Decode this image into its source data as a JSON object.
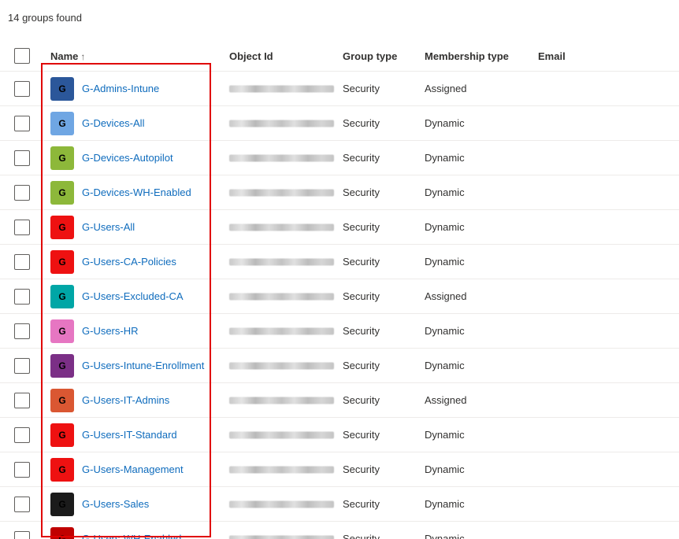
{
  "summary": "14 groups found",
  "columns": {
    "name": "Name",
    "sort_indicator": "↑",
    "object_id": "Object Id",
    "group_type": "Group type",
    "membership_type": "Membership type",
    "email": "Email"
  },
  "rows": [
    {
      "initial": "G",
      "name": "G-Admins-Intune",
      "group_type": "Security",
      "membership_type": "Assigned",
      "color": "#2b579a"
    },
    {
      "initial": "G",
      "name": "G-Devices-All",
      "group_type": "Security",
      "membership_type": "Dynamic",
      "color": "#6fa6e3"
    },
    {
      "initial": "G",
      "name": "G-Devices-Autopilot",
      "group_type": "Security",
      "membership_type": "Dynamic",
      "color": "#8db83a"
    },
    {
      "initial": "G",
      "name": "G-Devices-WH-Enabled",
      "group_type": "Security",
      "membership_type": "Dynamic",
      "color": "#8db83a"
    },
    {
      "initial": "G",
      "name": "G-Users-All",
      "group_type": "Security",
      "membership_type": "Dynamic",
      "color": "#ee1111"
    },
    {
      "initial": "G",
      "name": "G-Users-CA-Policies",
      "group_type": "Security",
      "membership_type": "Dynamic",
      "color": "#ee1111"
    },
    {
      "initial": "G",
      "name": "G-Users-Excluded-CA",
      "group_type": "Security",
      "membership_type": "Assigned",
      "color": "#00a6a6"
    },
    {
      "initial": "G",
      "name": "G-Users-HR",
      "group_type": "Security",
      "membership_type": "Dynamic",
      "color": "#e676c2"
    },
    {
      "initial": "G",
      "name": "G-Users-Intune-Enrollment",
      "group_type": "Security",
      "membership_type": "Dynamic",
      "color": "#7b2f86"
    },
    {
      "initial": "G",
      "name": "G-Users-IT-Admins",
      "group_type": "Security",
      "membership_type": "Assigned",
      "color": "#da5732"
    },
    {
      "initial": "G",
      "name": "G-Users-IT-Standard",
      "group_type": "Security",
      "membership_type": "Dynamic",
      "color": "#ee1111"
    },
    {
      "initial": "G",
      "name": "G-Users-Management",
      "group_type": "Security",
      "membership_type": "Dynamic",
      "color": "#ee1111"
    },
    {
      "initial": "G",
      "name": "G-Users-Sales",
      "group_type": "Security",
      "membership_type": "Dynamic",
      "color": "#1b1b1b"
    },
    {
      "initial": "G",
      "name": "G-Users-WH-Enabled",
      "group_type": "Security",
      "membership_type": "Dynamic",
      "color": "#c00000"
    }
  ],
  "highlight_color": "#e00000"
}
